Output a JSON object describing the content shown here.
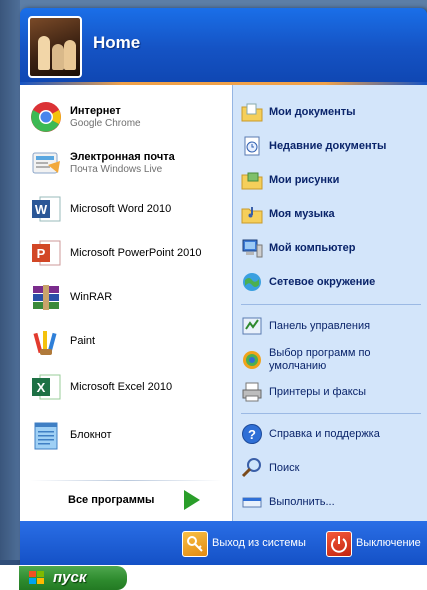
{
  "header": {
    "user_name": "Home"
  },
  "left_items": [
    {
      "title": "Интернет",
      "subtitle": "Google Chrome",
      "icon": "chrome-icon",
      "bold": true
    },
    {
      "title": "Электронная почта",
      "subtitle": "Почта Windows Live",
      "icon": "mail-icon",
      "bold": true
    },
    {
      "title": "Microsoft Word 2010",
      "icon": "word-icon"
    },
    {
      "title": "Microsoft PowerPoint 2010",
      "icon": "powerpoint-icon"
    },
    {
      "title": "WinRAR",
      "icon": "winrar-icon"
    },
    {
      "title": "Paint",
      "icon": "paint-icon"
    },
    {
      "title": "Microsoft Excel 2010",
      "icon": "excel-icon"
    },
    {
      "title": "Блокнот",
      "icon": "notepad-icon"
    }
  ],
  "all_programs_label": "Все программы",
  "right_items": [
    {
      "label": "Мои документы",
      "icon": "documents-folder-icon",
      "bold": true
    },
    {
      "label": "Недавние документы",
      "icon": "recent-documents-icon",
      "bold": true
    },
    {
      "label": "Мои рисунки",
      "icon": "pictures-folder-icon",
      "bold": true
    },
    {
      "label": "Моя музыка",
      "icon": "music-folder-icon",
      "bold": true
    },
    {
      "label": "Мой компьютер",
      "icon": "computer-icon",
      "bold": true
    },
    {
      "label": "Сетевое окружение",
      "icon": "network-icon",
      "bold": true
    },
    {
      "label": "Панель управления",
      "icon": "control-panel-icon"
    },
    {
      "label": "Выбор программ по умолчанию",
      "icon": "default-programs-icon"
    },
    {
      "label": "Принтеры и факсы",
      "icon": "printer-icon"
    },
    {
      "label": "Справка и поддержка",
      "icon": "help-icon"
    },
    {
      "label": "Поиск",
      "icon": "search-icon"
    },
    {
      "label": "Выполнить...",
      "icon": "run-icon"
    }
  ],
  "bottom": {
    "logoff_label": "Выход из системы",
    "shutdown_label": "Выключение"
  },
  "taskbar": {
    "start_label": "пуск"
  },
  "colors": {
    "menu_blue": "#1d5ad6",
    "right_pane": "#d3e5fa",
    "start_green": "#2d8a2d",
    "accent_orange": "#f0a24a"
  }
}
